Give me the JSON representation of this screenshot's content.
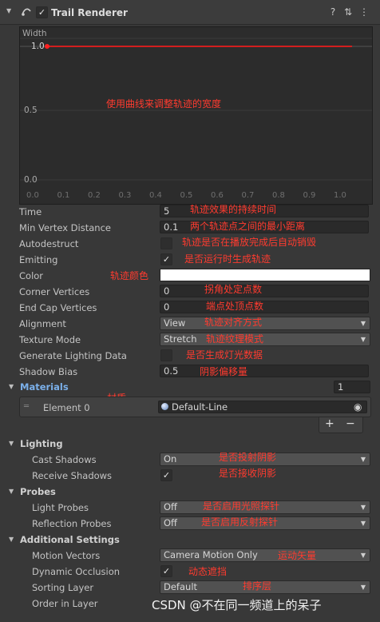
{
  "header": {
    "title": "Trail Renderer",
    "component_icon": "trail-renderer-icon",
    "enabled": "✓",
    "help_icon": "help-icon",
    "presets_icon": "presets-icon",
    "menu_icon": "more-menu-icon"
  },
  "curve": {
    "label": "Width",
    "value_label": "1.0",
    "y_ticks": [
      "0.5",
      "0.0"
    ],
    "x_ticks": [
      "0.0",
      "0.1",
      "0.2",
      "0.3",
      "0.4",
      "0.5",
      "0.6",
      "0.7",
      "0.8",
      "0.9",
      "1.0"
    ],
    "annotation": "使用曲线来调整轨迹的宽度",
    "line_color": "#d21e1e"
  },
  "rows": {
    "time": {
      "label": "Time",
      "value": "5",
      "annotation": "轨迹效果的持续时间"
    },
    "min_vertex": {
      "label": "Min Vertex Distance",
      "value": "0.1",
      "annotation": "两个轨迹点之间的最小距离"
    },
    "autodestruct": {
      "label": "Autodestruct",
      "annotation": "轨迹是否在播放完成后自动销毁"
    },
    "emitting": {
      "label": "Emitting",
      "check": "✓",
      "annotation": "是否运行时生成轨迹"
    },
    "color": {
      "label": "Color",
      "annotation": "轨迹颜色",
      "swatch": "#ffffff"
    },
    "corner_vertices": {
      "label": "Corner Vertices",
      "value": "0",
      "annotation": "拐角处定点数"
    },
    "end_cap_vertices": {
      "label": "End Cap Vertices",
      "value": "0",
      "annotation": "端点处顶点数"
    },
    "alignment": {
      "label": "Alignment",
      "value": "View",
      "annotation": "轨迹对齐方式"
    },
    "texture_mode": {
      "label": "Texture Mode",
      "value": "Stretch",
      "annotation": "轨迹纹理模式"
    },
    "lighting_data": {
      "label": "Generate Lighting Data",
      "annotation": "是否生成灯光数据"
    },
    "shadow_bias": {
      "label": "Shadow Bias",
      "value": "0.5",
      "annotation": "阴影偏移量"
    }
  },
  "materials": {
    "label": "Materials",
    "count": "1",
    "annotation": "材质",
    "element_label": "Element 0",
    "element_value": "Default-Line",
    "add": "+",
    "remove": "−"
  },
  "lighting": {
    "label": "Lighting",
    "cast_shadows": {
      "label": "Cast Shadows",
      "value": "On",
      "annotation": "是否投射阴影"
    },
    "receive_shadows": {
      "label": "Receive Shadows",
      "check": "✓",
      "annotation": "是否接收阴影"
    }
  },
  "probes": {
    "label": "Probes",
    "light_probes": {
      "label": "Light Probes",
      "value": "Off",
      "annotation": "是否启用光照探针"
    },
    "reflection_probes": {
      "label": "Reflection Probes",
      "value": "Off",
      "annotation": "是否启用反射探针"
    }
  },
  "additional": {
    "label": "Additional Settings",
    "motion_vectors": {
      "label": "Motion Vectors",
      "value": "Camera Motion Only",
      "annotation": "运动矢量"
    },
    "dynamic_occlusion": {
      "label": "Dynamic Occlusion",
      "check": "✓",
      "annotation": "动态遮挡"
    },
    "sorting_layer": {
      "label": "Sorting Layer",
      "value": "Default",
      "annotation": "排序层"
    },
    "order_in_layer": {
      "label": "Order in Layer"
    }
  },
  "watermark": "CSDN @不在同一频道上的呆子"
}
